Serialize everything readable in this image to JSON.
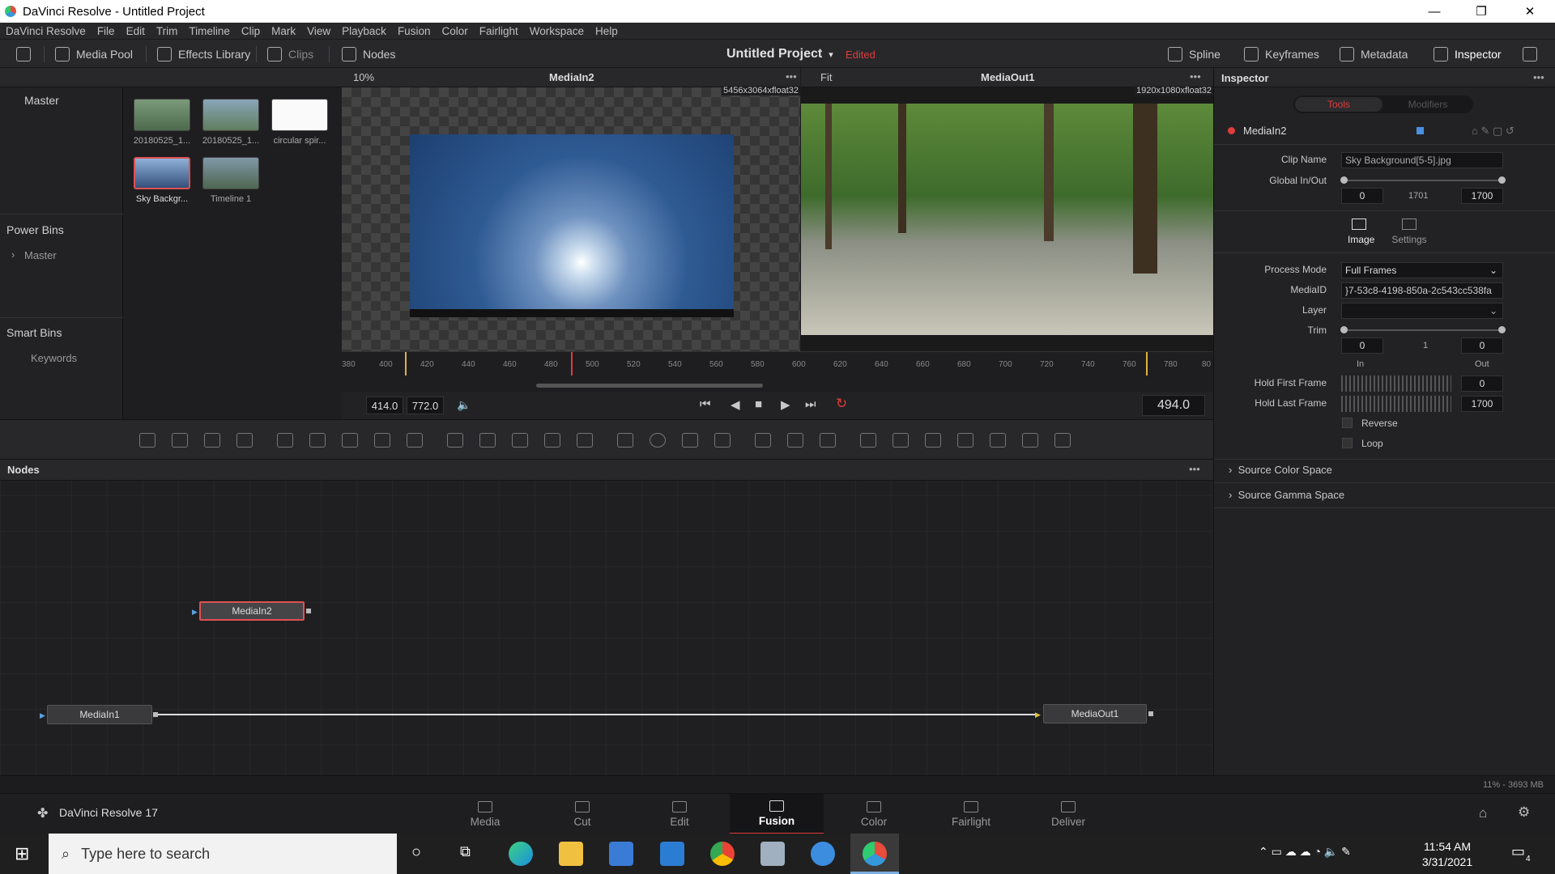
{
  "window": {
    "title": "DaVinci Resolve - Untitled Project",
    "min": "—",
    "max": "❐",
    "close": "✕"
  },
  "menu": [
    "DaVinci Resolve",
    "File",
    "Edit",
    "Trim",
    "Timeline",
    "Clip",
    "Mark",
    "View",
    "Playback",
    "Fusion",
    "Color",
    "Fairlight",
    "Workspace",
    "Help"
  ],
  "toolbar": {
    "media_pool": "Media Pool",
    "effects_library": "Effects Library",
    "clips": "Clips",
    "nodes": "Nodes",
    "project": "Untitled Project",
    "edited": "Edited",
    "spline": "Spline",
    "keyframes": "Keyframes",
    "metadata": "Metadata",
    "inspector": "Inspector"
  },
  "bins": {
    "master": "Master",
    "power_bins": "Power Bins",
    "power_master": "Master",
    "smart_bins": "Smart Bins",
    "keywords": "Keywords"
  },
  "clips": [
    {
      "label": "20180525_1..."
    },
    {
      "label": "20180525_1..."
    },
    {
      "label": "circular spir..."
    },
    {
      "label": "Sky Backgr..."
    },
    {
      "label": "Timeline 1"
    }
  ],
  "viewer_left": {
    "zoom": "10%",
    "name": "MediaIn2",
    "res": "5456x3064xfloat32"
  },
  "viewer_right": {
    "zoom": "Fit",
    "name": "MediaOut1",
    "res": "1920x1080xfloat32"
  },
  "ruler": [
    "380",
    "400",
    "420",
    "440",
    "460",
    "480",
    "500",
    "520",
    "540",
    "560",
    "580",
    "600",
    "620",
    "640",
    "660",
    "680",
    "700",
    "720",
    "740",
    "760",
    "780",
    "80"
  ],
  "transport": {
    "start": "414.0",
    "end": "772.0",
    "current": "494.0"
  },
  "nodes_panel": {
    "title": "Nodes",
    "more": "•••",
    "n_mediain2": "MediaIn2",
    "n_mediain1": "MediaIn1",
    "n_mediaout1": "MediaOut1"
  },
  "inspector": {
    "title": "Inspector",
    "tab_tools": "Tools",
    "tab_modifiers": "Modifiers",
    "node_name": "MediaIn2",
    "clip_name_label": "Clip Name",
    "clip_name": "Sky Background[5-5].jpg",
    "global_label": "Global In/Out",
    "global_in": "0",
    "global_mid": "1701",
    "global_out": "1700",
    "tab_image": "Image",
    "tab_settings": "Settings",
    "process_mode_label": "Process Mode",
    "process_mode": "Full Frames",
    "mediaid_label": "MediaID",
    "mediaid": "}7-53c8-4198-850a-2c543cc538fa",
    "layer_label": "Layer",
    "trim_label": "Trim",
    "trim_in": "0",
    "trim_mid": "1",
    "trim_out": "0",
    "in_label": "In",
    "out_label": "Out",
    "hold_first_label": "Hold First Frame",
    "hold_first": "0",
    "hold_last_label": "Hold Last Frame",
    "hold_last": "1700",
    "reverse": "Reverse",
    "loop": "Loop",
    "source_color": "Source Color Space",
    "source_gamma": "Source Gamma Space"
  },
  "status": {
    "mem": "11% - 3693 MB"
  },
  "app": {
    "name": "DaVinci Resolve 17"
  },
  "pages": [
    "Media",
    "Cut",
    "Edit",
    "Fusion",
    "Color",
    "Fairlight",
    "Deliver"
  ],
  "taskbar": {
    "search_placeholder": "Type here to search",
    "time": "11:54 AM",
    "date": "3/31/2021",
    "notif": "4"
  },
  "colors": {
    "accent": "#e03c3c",
    "active_node": "#e05050",
    "timeline_line": "#dddddd"
  }
}
